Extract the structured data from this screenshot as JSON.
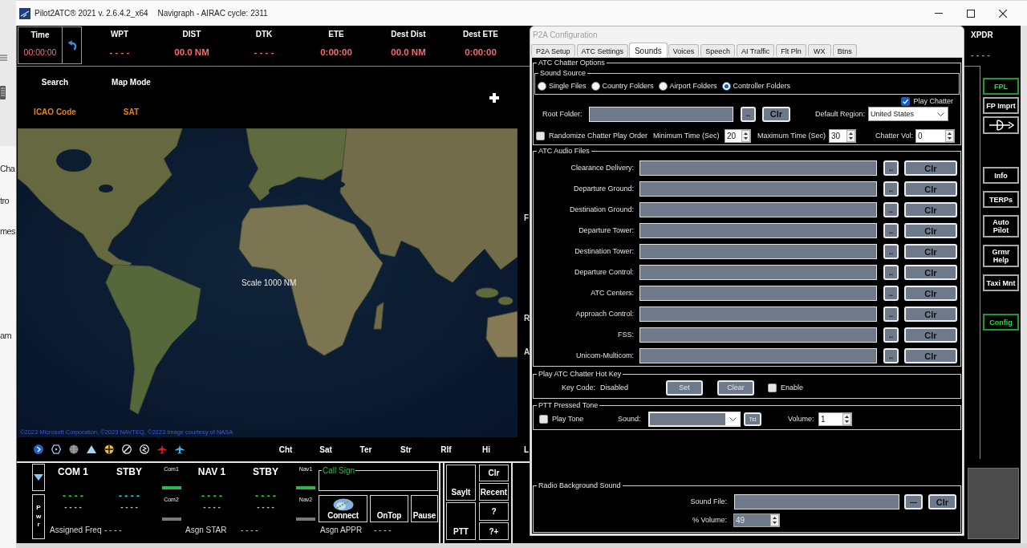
{
  "background_page": {
    "texts": [
      "Cha",
      "tro",
      "mes",
      "am"
    ]
  },
  "window": {
    "title": "Pilot2ATC® 2021 v. 2.6.4.2_x64",
    "subtitle": "Navigraph - AIRAC cycle: 2311"
  },
  "flight_data": {
    "time": {
      "label": "Time",
      "value": "00:00:00"
    },
    "fields": [
      {
        "label": "WPT",
        "value": "- - - -"
      },
      {
        "label": "DIST",
        "value": "00.0 NM"
      },
      {
        "label": "DTK",
        "value": "- - - -"
      },
      {
        "label": "ETE",
        "value": "0:00:00"
      },
      {
        "label": "Dest Dist",
        "value": "00.0 NM"
      },
      {
        "label": "Dest ETE",
        "value": "0:00:00"
      }
    ]
  },
  "map_controls": [
    {
      "label": "Search",
      "value": "ICAO Code"
    },
    {
      "label": "Map Mode",
      "value": "SAT"
    }
  ],
  "map": {
    "scale": "Scale 1000 NM",
    "attribution": "©2023 Microsoft Corporation, ©2023 NAVTEQ, ©2023 Image courtesy of NASA"
  },
  "partial_labels": [
    "F",
    "R",
    "A"
  ],
  "map_layers": [
    "Cht",
    "Sat",
    "Ter",
    "Str",
    "Rlf",
    "Hi",
    "L"
  ],
  "radio_panel": {
    "power": "Pwr",
    "radios": [
      {
        "label": "COM 1",
        "value": "- - - -",
        "color": "#22dd22",
        "secondary": "- - - -"
      },
      {
        "label": "STBY",
        "value": "- - - -",
        "color": "#22d4ee",
        "secondary": "- - - -"
      },
      {
        "label": "NAV 1",
        "value": "- - - -",
        "color": "#22dd22",
        "secondary": "- - - -"
      },
      {
        "label": "STBY",
        "value": "- - - -",
        "color": "#22dd22",
        "secondary": "- - - -"
      }
    ],
    "com_selector": [
      {
        "label": "Com1",
        "selected": true
      },
      {
        "label": "Com2",
        "selected": false
      }
    ],
    "nav_selector": [
      {
        "label": "Nav1",
        "selected": true
      },
      {
        "label": "Nav2",
        "selected": false
      }
    ],
    "call_sign": {
      "legend": "Call Sign"
    },
    "buttons": [
      {
        "label": "Connect",
        "kind": "icon"
      },
      {
        "label": "OnTop",
        "kind": "text"
      },
      {
        "label": "Pause",
        "kind": "text"
      }
    ],
    "assignments": [
      {
        "label": "Assigned Freq",
        "value": "- - - -"
      },
      {
        "label": "Asgn STAR",
        "value": "- - - -"
      },
      {
        "label": "Asgn APPR",
        "value": "- - - -"
      }
    ]
  },
  "action_buttons": [
    "SayIt",
    "PTT",
    "Clr",
    "Recent",
    "?",
    "?+"
  ],
  "transponder": {
    "label": "XPDR",
    "value": "- - - -"
  },
  "side_buttons": [
    [
      {
        "kind": "text",
        "label": "FPL",
        "highlighted": true
      },
      {
        "kind": "text",
        "label": "FP Imprt",
        "highlighted": false
      },
      {
        "kind": "icon",
        "highlighted": false
      }
    ],
    [
      {
        "kind": "text",
        "label": "Info",
        "highlighted": false
      },
      {
        "kind": "text",
        "label": "TERPs",
        "highlighted": false
      },
      {
        "kind": "text",
        "label": "Auto Pilot",
        "highlighted": false
      },
      {
        "kind": "text",
        "label": "Grmr Help",
        "highlighted": false
      },
      {
        "kind": "text",
        "label": "Taxi Mnt",
        "highlighted": false
      }
    ],
    [
      {
        "kind": "text",
        "label": "Config",
        "highlighted": true
      }
    ]
  ],
  "config_dialog": {
    "title": "P2A Configuration",
    "tabs": [
      {
        "label": "P2A Setup",
        "selected": false
      },
      {
        "label": "ATC Settings",
        "selected": false
      },
      {
        "label": "Sounds",
        "selected": true
      },
      {
        "label": "Voices",
        "selected": false
      },
      {
        "label": "Speech",
        "selected": false
      },
      {
        "label": "AI Traffic",
        "selected": false
      },
      {
        "label": "Flt Pln",
        "selected": false
      },
      {
        "label": "WX",
        "selected": false
      },
      {
        "label": "Btns",
        "selected": false
      }
    ],
    "chatter_options": {
      "legend": "ATC Chatter Options",
      "sound_source": {
        "legend": "Sound Source",
        "options": [
          {
            "label": "Single Files",
            "selected": false
          },
          {
            "label": "Country Folders",
            "selected": false
          },
          {
            "label": "Airport Folders",
            "selected": false
          },
          {
            "label": "Controller Folders",
            "selected": true
          }
        ]
      },
      "play_chatter": {
        "label": "Play Chatter",
        "checked": true
      },
      "root_folder": {
        "label": "Root Folder:",
        "browse": "..",
        "clear": "Clr"
      },
      "default_region": {
        "label": "Default Region:",
        "value": "United States"
      },
      "randomize": {
        "label": "Randomize Chatter Play Order",
        "checked": false
      },
      "spinners": [
        {
          "label": "Minimum Time (Sec)",
          "value": "20"
        },
        {
          "label": "Maximum Time (Sec)",
          "value": "30"
        },
        {
          "label": "Chatter Vol:",
          "value": "0"
        }
      ]
    },
    "audio_files": {
      "legend": "ATC Audio Files",
      "rows": [
        {
          "label": "Clearance Delivery:",
          "browse": "..",
          "clear": "Clr"
        },
        {
          "label": "Departure Ground:",
          "browse": "..",
          "clear": "Clr"
        },
        {
          "label": "Destination Ground:",
          "browse": "..",
          "clear": "Clr"
        },
        {
          "label": "Departure Tower:",
          "browse": "..",
          "clear": "Clr"
        },
        {
          "label": "Destination Tower:",
          "browse": "..",
          "clear": "Clr"
        },
        {
          "label": "Departure Control:",
          "browse": "..",
          "clear": "Clr"
        },
        {
          "label": "ATC Centers:",
          "browse": "..",
          "clear": "Clr"
        },
        {
          "label": "Approach Control:",
          "browse": "..",
          "clear": "Clr"
        },
        {
          "label": "FSS:",
          "browse": "..",
          "clear": "Clr"
        },
        {
          "label": "Unicom-Multicom:",
          "browse": "..",
          "clear": "Clr"
        }
      ]
    },
    "hot_key": {
      "legend": "Play ATC Chatter Hot Key",
      "key_code_label": "Key Code:",
      "key_code": "Disabled",
      "set": "Set",
      "clear": "Clear",
      "enable": {
        "label": "Enable",
        "checked": false
      }
    },
    "ptt_tone": {
      "legend": "PTT Pressed Tone",
      "play_tone": {
        "label": "Play Tone",
        "checked": false
      },
      "sound_label": "Sound:",
      "test": "Tst",
      "volume_label": "Volume:",
      "volume": "1"
    },
    "background_sound": {
      "legend": "Radio Background Sound",
      "file_label": "Sound File:",
      "browse": "—",
      "clear": "Clr",
      "volume_label": "% Volume:",
      "volume": "49"
    }
  }
}
